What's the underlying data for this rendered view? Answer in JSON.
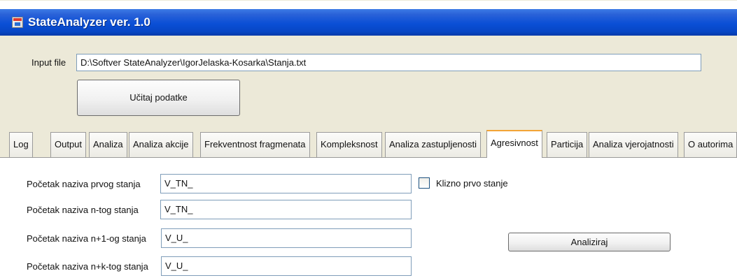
{
  "window": {
    "title": "StateAnalyzer ver. 1.0"
  },
  "input": {
    "label": "Input file",
    "value": "D:\\Softver StateAnalyzer\\IgorJelaska-Kosarka\\Stanja.txt"
  },
  "load_button": "Učitaj podatke",
  "tabs": [
    "Log",
    "Output",
    "Analiza",
    "Analiza akcije",
    "Frekventnost fragmenata",
    "Kompleksnost",
    "Analiza zastupljenosti",
    "Agresivnost",
    "Particija",
    "Analiza vjerojatnosti",
    "O autorima"
  ],
  "active_tab": "Agresivnost",
  "form": {
    "first_state_label": "Početak naziva prvog stanja",
    "first_state_value": "V_TN_",
    "nth_state_label": "Početak naziva n-tog stanja",
    "nth_state_value": "V_TN_",
    "n1_state_label": "Početak naziva n+1-og stanja",
    "n1_state_value": "V_U_",
    "nk_state_label": "Početak naziva n+k-tog stanja",
    "nk_state_value": "V_U_",
    "sliding_checkbox_label": "Klizno prvo stanje",
    "sliding_checked": false,
    "analyze_button": "Analiziraj"
  }
}
